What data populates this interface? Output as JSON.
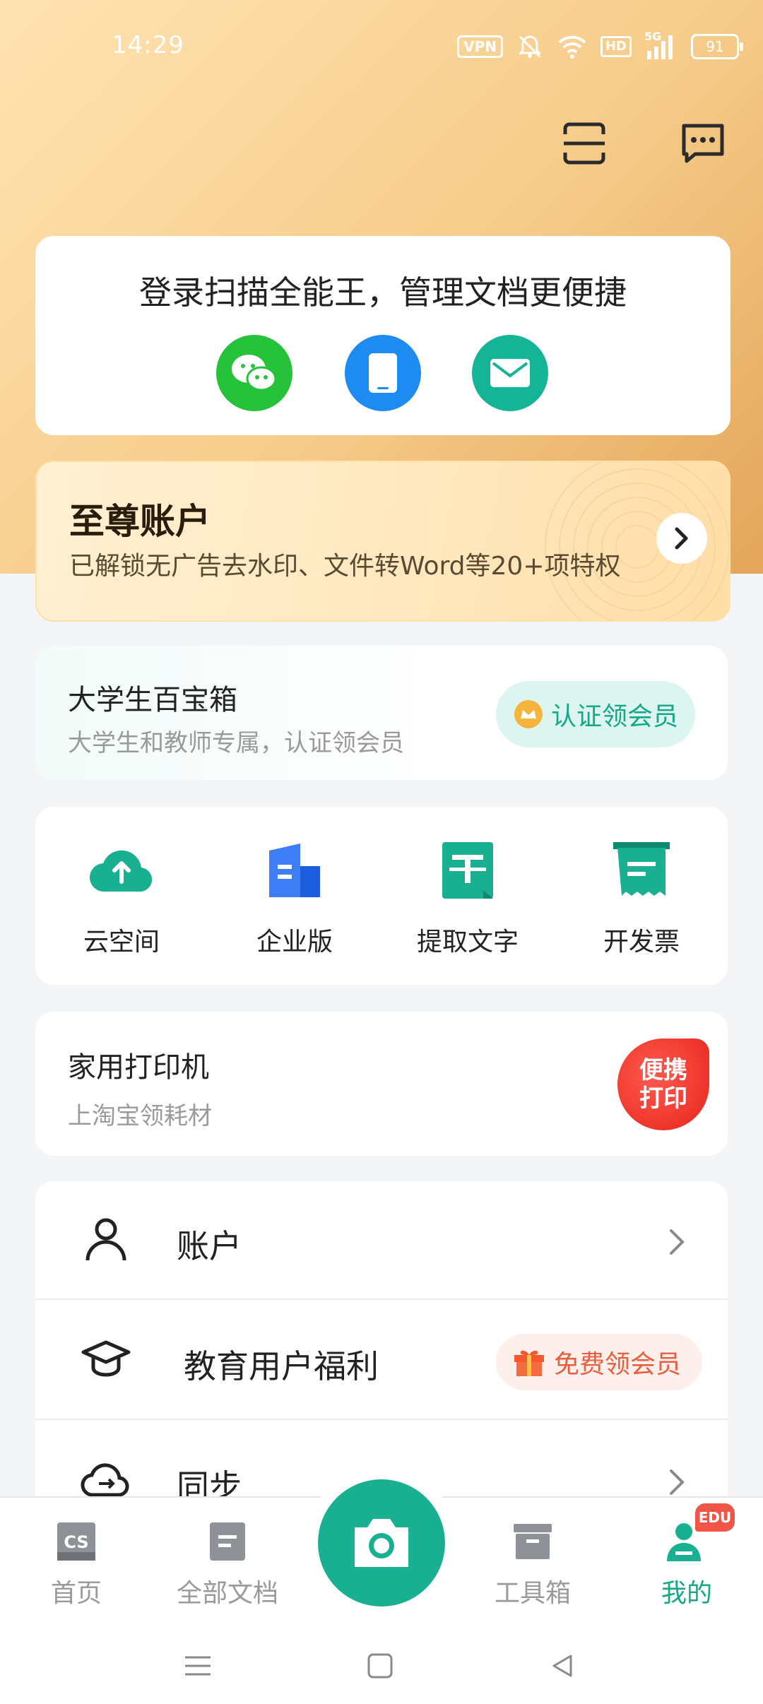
{
  "status_bar": {
    "time": "14:29",
    "vpn": "VPN",
    "hd": "HD",
    "network": "5G",
    "battery": "91"
  },
  "login": {
    "title": "登录扫描全能王，管理文档更便捷",
    "options": [
      "wechat-login",
      "phone-login",
      "email-login"
    ]
  },
  "premium": {
    "title": "至尊账户",
    "subtitle": "已解锁无广告去水印、文件转Word等20+项特权"
  },
  "edu_toolbox": {
    "title": "大学生百宝箱",
    "subtitle": "大学生和教师专属，认证领会员",
    "button": "认证领会员"
  },
  "quick_tools": [
    {
      "label": "云空间",
      "icon": "cloud-upload-icon"
    },
    {
      "label": "企业版",
      "icon": "building-icon"
    },
    {
      "label": "提取文字",
      "icon": "text-extract-icon"
    },
    {
      "label": "开发票",
      "icon": "invoice-icon"
    }
  ],
  "printer": {
    "title": "家用打印机",
    "subtitle": "上淘宝领耗材",
    "badge_line1": "便携",
    "badge_line2": "打印"
  },
  "list": [
    {
      "label": "账户",
      "icon": "user-icon"
    },
    {
      "label": "教育用户福利",
      "icon": "graduation-cap-icon",
      "badge": "免费领会员"
    },
    {
      "label": "同步",
      "icon": "cloud-sync-icon"
    }
  ],
  "tabs": [
    {
      "label": "首页",
      "icon": "cs-logo-icon"
    },
    {
      "label": "全部文档",
      "icon": "document-icon"
    },
    {
      "label": "工具箱",
      "icon": "toolbox-icon"
    },
    {
      "label": "我的",
      "icon": "profile-icon",
      "tag": "EDU",
      "active": true
    }
  ],
  "colors": {
    "accent": "#19B091",
    "header_gold": "#E3A55A",
    "badge_red": "#E7241C"
  }
}
